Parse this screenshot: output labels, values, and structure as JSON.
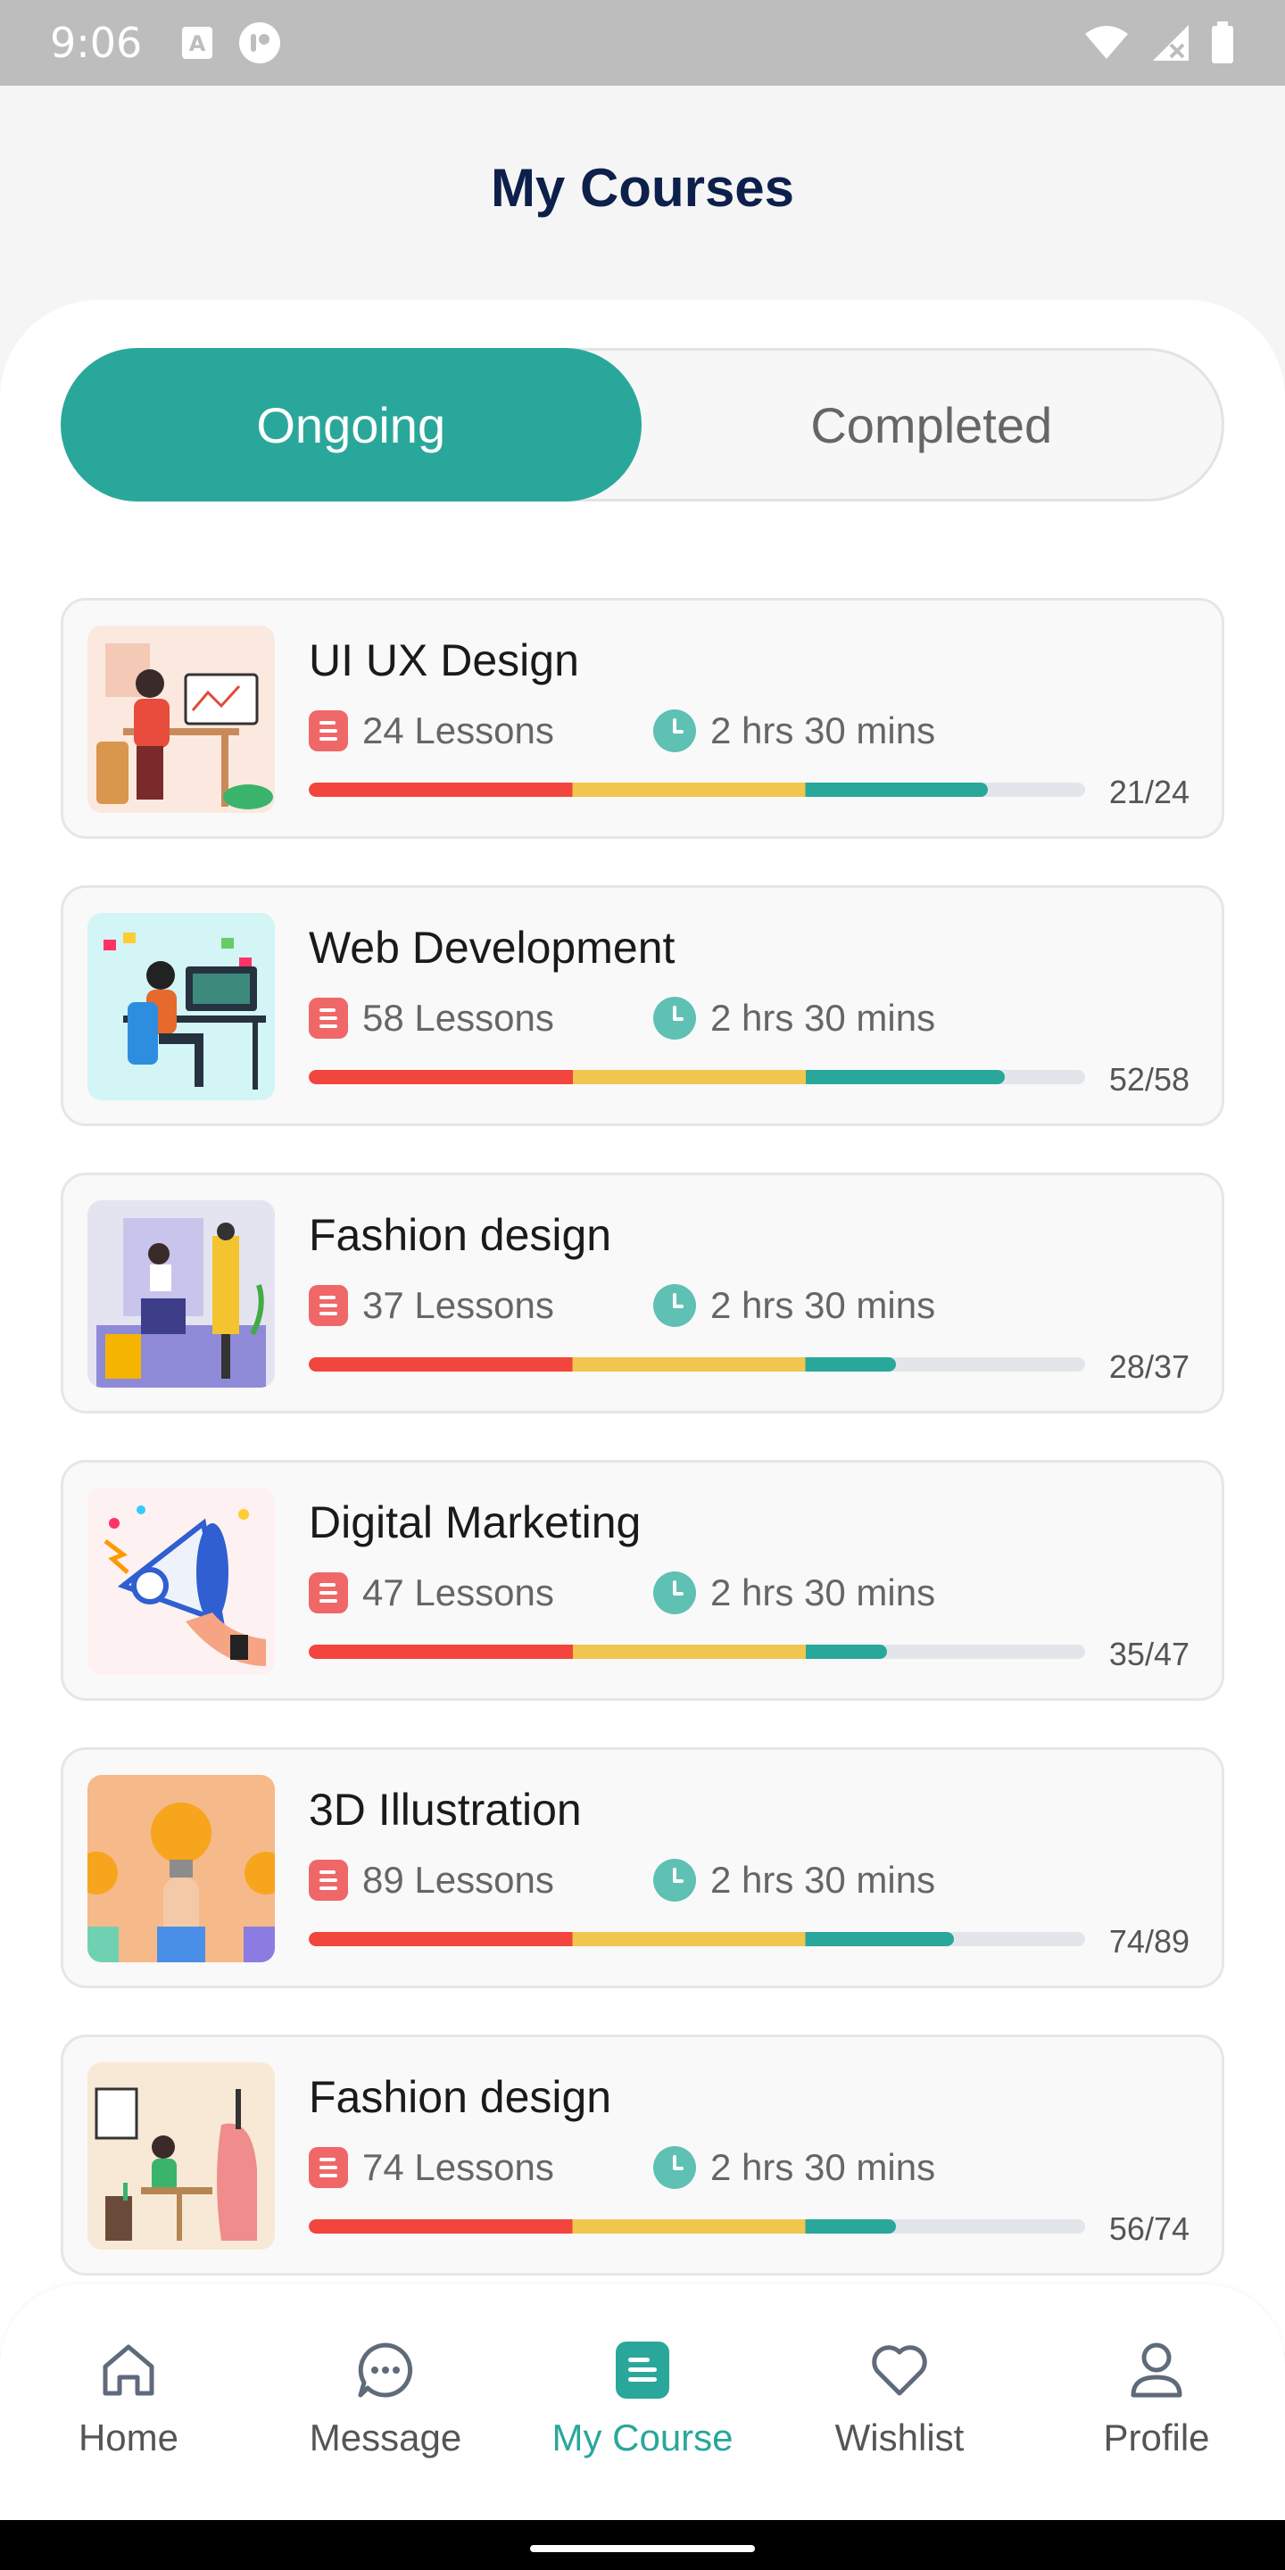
{
  "status_bar": {
    "time": "9:06"
  },
  "header": {
    "title": "My Courses"
  },
  "tabs": [
    {
      "label": "Ongoing",
      "active": true
    },
    {
      "label": "Completed",
      "active": false
    }
  ],
  "progress_colors": {
    "start": "#f2453d",
    "middle": "#f0c64f",
    "end": "#2aa79b",
    "track": "#e2e6ea"
  },
  "courses": [
    {
      "title": "UI UX Design",
      "lessons": "24 Lessons",
      "duration": "2 hrs 30 mins",
      "progress": "21/24",
      "completed": 21,
      "total": 24,
      "thumb_bg": "#fbe9e0"
    },
    {
      "title": "Web Development",
      "lessons": "58 Lessons",
      "duration": "2 hrs 30 mins",
      "progress": "52/58",
      "completed": 52,
      "total": 58,
      "thumb_bg": "#d3f5f5"
    },
    {
      "title": "Fashion design",
      "lessons": "37 Lessons",
      "duration": "2 hrs 30 mins",
      "progress": "28/37",
      "completed": 28,
      "total": 37,
      "thumb_bg": "#e4e4f0"
    },
    {
      "title": "Digital Marketing",
      "lessons": "47 Lessons",
      "duration": "2 hrs 30 mins",
      "progress": "35/47",
      "completed": 35,
      "total": 47,
      "thumb_bg": "#fdf1f1"
    },
    {
      "title": "3D Illustration",
      "lessons": "89 Lessons",
      "duration": "2 hrs 30 mins",
      "progress": "74/89",
      "completed": 74,
      "total": 89,
      "thumb_bg": "#f6b98a"
    },
    {
      "title": "Fashion design",
      "lessons": "74 Lessons",
      "duration": "2 hrs 30 mins",
      "progress": "56/74",
      "completed": 56,
      "total": 74,
      "thumb_bg": "#f7e9d6"
    }
  ],
  "bottom_nav": [
    {
      "label": "Home",
      "icon": "home-icon",
      "active": false
    },
    {
      "label": "Message",
      "icon": "message-icon",
      "active": false
    },
    {
      "label": "My Course",
      "icon": "course-icon",
      "active": true
    },
    {
      "label": "Wishlist",
      "icon": "heart-icon",
      "active": false
    },
    {
      "label": "Profile",
      "icon": "profile-icon",
      "active": false
    }
  ]
}
